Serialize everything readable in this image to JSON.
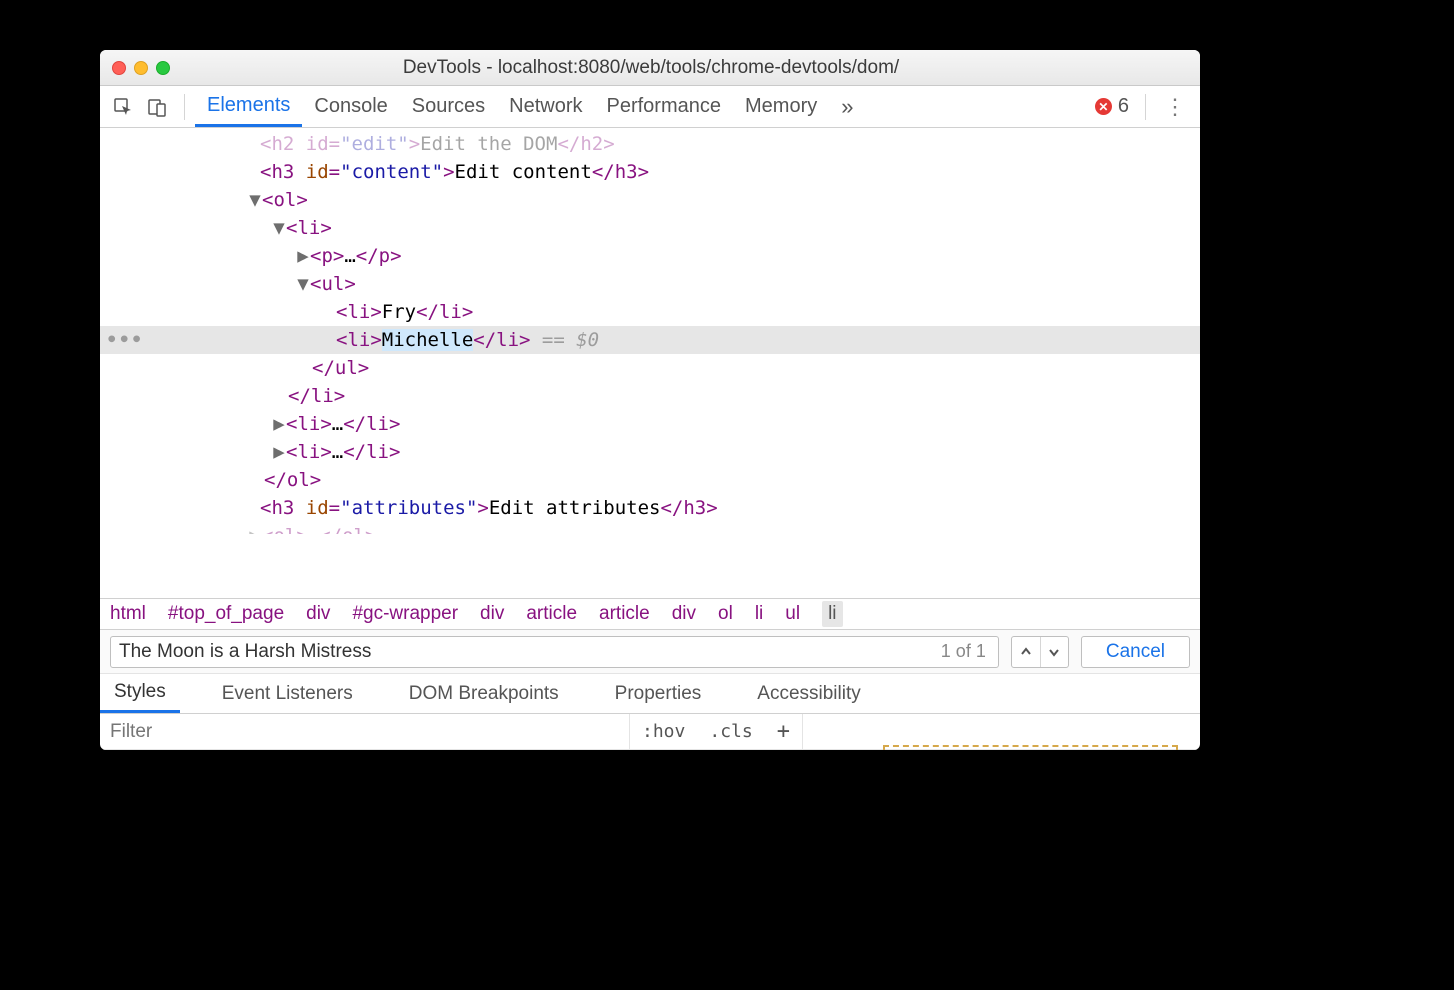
{
  "window": {
    "title": "DevTools - localhost:8080/web/tools/chrome-devtools/dom/"
  },
  "tabs": {
    "items": [
      "Elements",
      "Console",
      "Sources",
      "Network",
      "Performance",
      "Memory"
    ],
    "active_index": 0,
    "overflow_glyph": "»",
    "error_count": "6"
  },
  "dom": {
    "cutoff_line": "<h2 id=\"edit\">Edit the DOM</h2>",
    "h3_content_id": "content",
    "h3_content_text": "Edit content",
    "li_fry": "Fry",
    "li_michelle": "Michelle",
    "sel_suffix": " == $0",
    "h3_attr_id": "attributes",
    "h3_attr_text": "Edit attributes"
  },
  "breadcrumbs": [
    "html",
    "#top_of_page",
    "div",
    "#gc-wrapper",
    "div",
    "article",
    "article",
    "div",
    "ol",
    "li",
    "ul",
    "li"
  ],
  "search": {
    "value": "The Moon is a Harsh Mistress",
    "count": "1 of 1",
    "cancel": "Cancel"
  },
  "subtabs": {
    "items": [
      "Styles",
      "Event Listeners",
      "DOM Breakpoints",
      "Properties",
      "Accessibility"
    ],
    "active_index": 0
  },
  "filter": {
    "placeholder": "Filter",
    "hov": ":hov",
    "cls": ".cls",
    "plus": "+"
  }
}
